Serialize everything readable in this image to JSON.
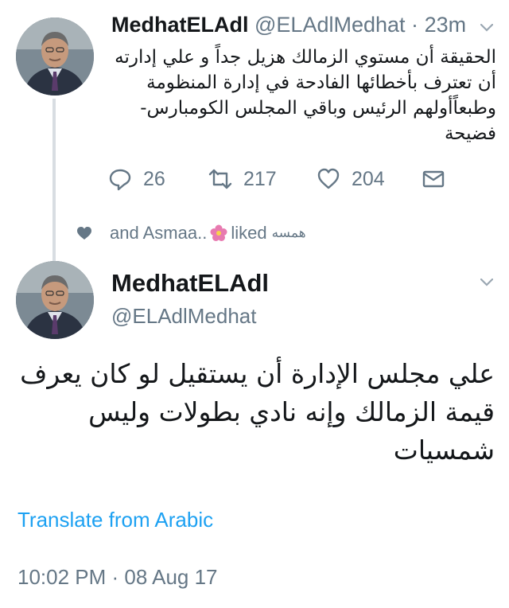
{
  "tweet1": {
    "author_name": "MedhatELAdl",
    "author_handle": "@ELAdlMedhat",
    "separator": "·",
    "time_ago": "23m",
    "lines": [
      "الحقيقة أن مستوي الزمالك هزيل جداً و علي إدارته",
      "أن تعترف بأخطائها الفادحة في إدارة المنظومة",
      "وطبعاًأولهم الرئيس وباقي المجلس الكومبارس-",
      "فضيحة"
    ],
    "replies": "26",
    "retweets": "217",
    "likes": "204"
  },
  "liked_bar": {
    "arabic_name": "همسه",
    "text_liked": "liked",
    "text_names": "and Asmaa.."
  },
  "tweet2": {
    "author_name": "MedhatELAdl",
    "author_handle": "@ELAdlMedhat",
    "lines": [
      "علي مجلس الإدارة أن يستقيل لو كان يعرف",
      "قيمة الزمالك وإنه نادي بطولات وليس",
      "شمسيات"
    ],
    "translate_link": "Translate from Arabic",
    "timestamp": "10:02 PM · 08 Aug 17"
  },
  "icons": {
    "reply": "reply-icon",
    "retweet": "retweet-icon",
    "like": "heart-icon",
    "share": "envelope-icon",
    "menu": "chevron-down-icon",
    "liked_heart": "small-heart-icon",
    "flower": "flower-emoji-icon"
  },
  "colors": {
    "link": "#1da1f2",
    "secondary_text": "#657786",
    "primary_text": "#14171a",
    "flower": "#e87ab0"
  }
}
